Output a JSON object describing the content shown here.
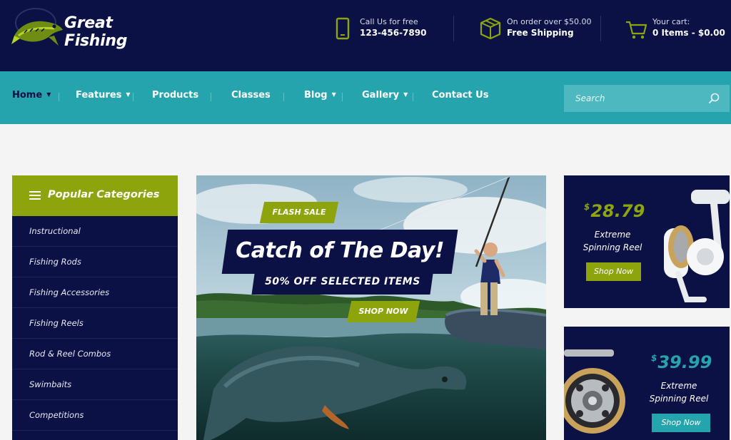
{
  "brand": {
    "name_line1": "Great",
    "name_line2": "Fishing"
  },
  "header_info": {
    "phone": {
      "label": "Call Us for free",
      "value": "123-456-7890",
      "icon": "phone-icon"
    },
    "shipping": {
      "label": "On order over $50.00",
      "value": "Free Shipping",
      "icon": "box-icon"
    },
    "cart": {
      "label": "Your cart:",
      "value": "0 Items - $0.00",
      "icon": "cart-icon"
    }
  },
  "nav": {
    "items": [
      {
        "label": "Home",
        "has_dropdown": true,
        "active": true
      },
      {
        "label": "Features",
        "has_dropdown": true
      },
      {
        "label": "Products",
        "has_dropdown": false
      },
      {
        "label": "Classes",
        "has_dropdown": false
      },
      {
        "label": "Blog",
        "has_dropdown": true
      },
      {
        "label": "Gallery",
        "has_dropdown": true
      },
      {
        "label": "Contact Us",
        "has_dropdown": false
      }
    ],
    "search_placeholder": "Search"
  },
  "sidebar": {
    "title": "Popular Categories",
    "items": [
      "Instructional",
      "Fishing Rods",
      "Fishing Accessories",
      "Fishing Reels",
      "Rod & Reel Combos",
      "Swimbaits",
      "Competitions"
    ]
  },
  "hero": {
    "badge": "FLASH SALE",
    "headline": "Catch of The Day!",
    "subheadline": "50% OFF SELECTED ITEMS",
    "cta": "SHOP NOW"
  },
  "promos": [
    {
      "currency": "$",
      "price": "28.79",
      "name_line1": "Extreme",
      "name_line2": "Spinning Reel",
      "cta": "Shop Now",
      "accent": "#8ea40d"
    },
    {
      "currency": "$",
      "price": "39.99",
      "name_line1": "Extreme",
      "name_line2": "Spinning Reel",
      "cta": "Shop Now",
      "accent": "#26a4ad"
    }
  ],
  "colors": {
    "navy": "#0b1145",
    "teal": "#26a4ad",
    "green": "#8ea40d",
    "page_bg": "#f4f4f4"
  }
}
